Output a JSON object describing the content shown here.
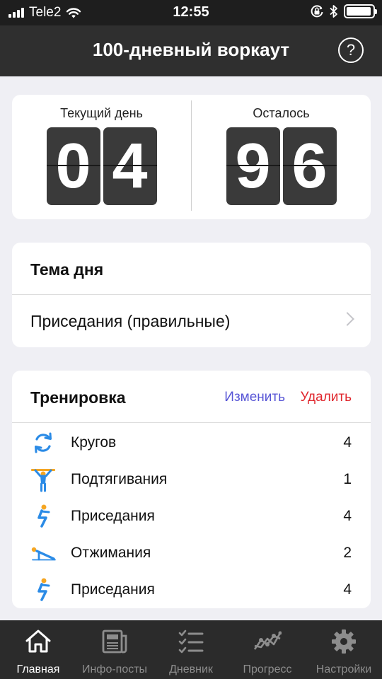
{
  "status_bar": {
    "carrier": "Tele2",
    "time": "12:55",
    "battery_level": 0.95,
    "icons": [
      "signal-icon",
      "wifi-icon",
      "orientation-lock-icon",
      "bluetooth-icon",
      "battery-icon"
    ]
  },
  "header": {
    "title": "100-дневный воркаут",
    "help_label": "?"
  },
  "counter": {
    "current": {
      "label": "Текущий день",
      "digits": [
        "0",
        "4"
      ]
    },
    "remaining": {
      "label": "Осталось",
      "digits": [
        "9",
        "6"
      ]
    }
  },
  "theme": {
    "heading": "Тема дня",
    "value": "Приседания (правильные)"
  },
  "workout": {
    "heading": "Тренировка",
    "edit_label": "Изменить",
    "delete_label": "Удалить",
    "exercises": [
      {
        "icon": "laps-icon",
        "name": "Кругов",
        "count": "4"
      },
      {
        "icon": "pullup-icon",
        "name": "Подтягивания",
        "count": "1"
      },
      {
        "icon": "squat-icon",
        "name": "Приседания",
        "count": "4"
      },
      {
        "icon": "pushup-icon",
        "name": "Отжимания",
        "count": "2"
      },
      {
        "icon": "squat-icon",
        "name": "Приседания",
        "count": "4"
      }
    ]
  },
  "tab_bar": {
    "active_tab": "home",
    "tabs": [
      {
        "id": "home",
        "icon": "home-icon",
        "label": "Главная"
      },
      {
        "id": "info",
        "icon": "newspaper-icon",
        "label": "Инфо-посты"
      },
      {
        "id": "diary",
        "icon": "checklist-icon",
        "label": "Дневник"
      },
      {
        "id": "progress",
        "icon": "progress-chart-icon",
        "label": "Прогресс"
      },
      {
        "id": "settings",
        "icon": "gear-icon",
        "label": "Настройки"
      }
    ]
  },
  "colors": {
    "accent_blue": "#2b8be6",
    "accent_orange": "#f5a623",
    "edit_purple": "#5856d6",
    "delete_red": "#e0262d",
    "header_dark": "#2f2f2f"
  }
}
